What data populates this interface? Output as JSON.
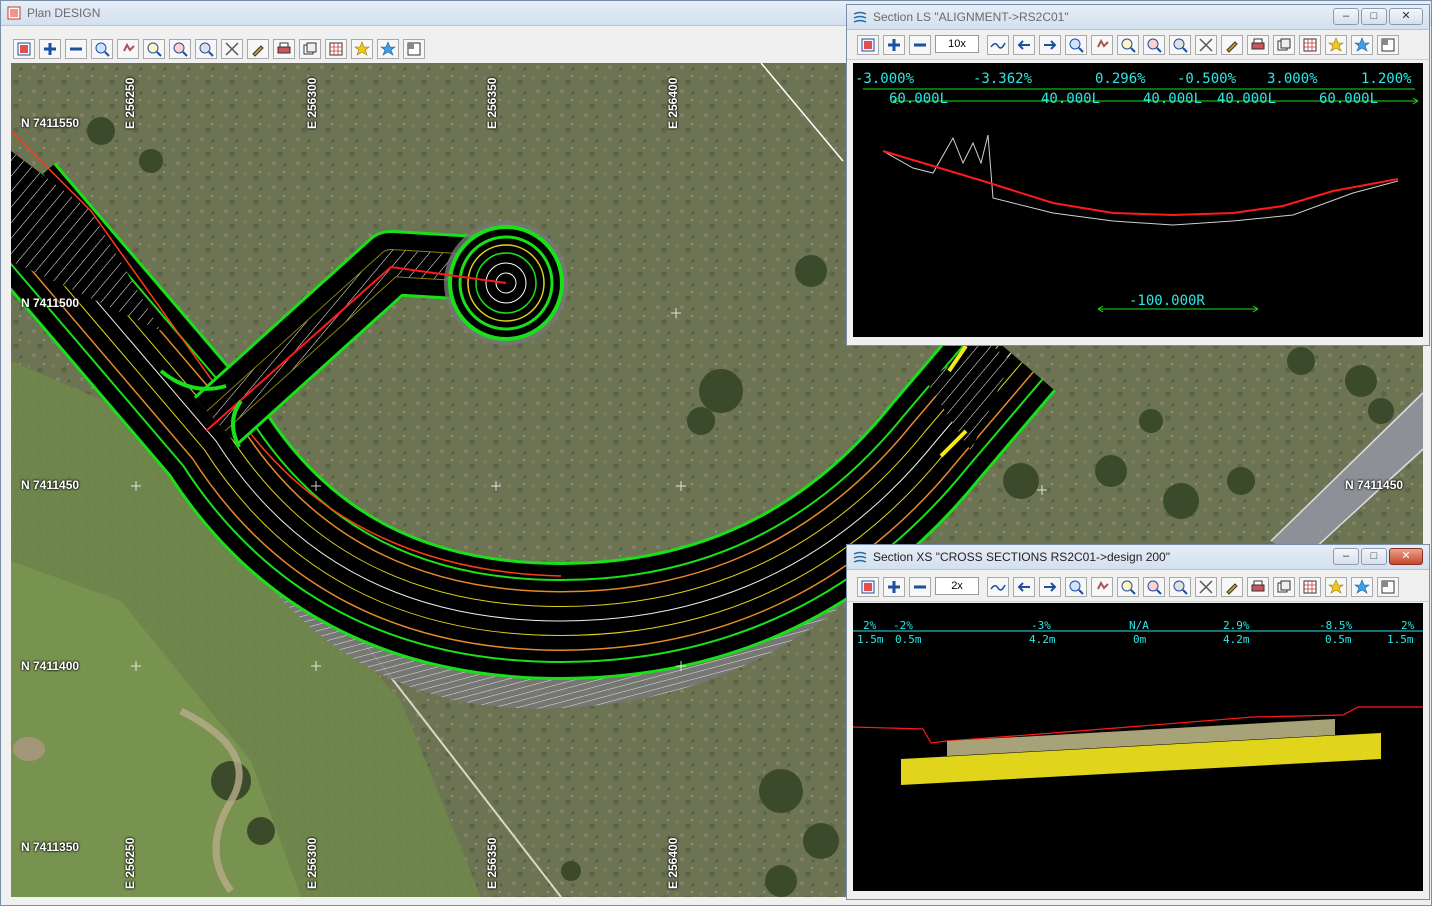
{
  "plan": {
    "title": "Plan DESIGN",
    "grid_north": [
      "N 7411550",
      "N 7411500",
      "N 7411450",
      "N 7411400",
      "N 7411350"
    ],
    "grid_north_right": "N 7411450",
    "grid_east": [
      "E 256250",
      "E 256300",
      "E 256350",
      "E 256400"
    ]
  },
  "ls": {
    "title": "Section LS \"ALIGNMENT->RS2C01\"",
    "zoom": "10x",
    "grades": [
      "-3.000%",
      "-3.362%",
      "0.296%",
      "-0.500%",
      "3.000%",
      "1.200%"
    ],
    "lengths": [
      "60.000L",
      "40.000L",
      "40.000L",
      "40.000L",
      "60.000L"
    ],
    "curve": "-100.000R"
  },
  "xs": {
    "title": "Section XS \"CROSS SECTIONS RS2C01->design 200\"",
    "zoom": "2x",
    "top_labels": [
      "2%",
      "-2%",
      "-3%",
      "N/A",
      "2.9%",
      "-8.5%",
      "2%"
    ],
    "bottom_labels": [
      "1.5m",
      "0.5m",
      "4.2m",
      "0m",
      "4.2m",
      "0.5m",
      "1.5m"
    ]
  },
  "toolbar_icons": [
    "layers-icon",
    "plus-icon",
    "minus-icon",
    "zoom-in-icon",
    "pan-hand-icon",
    "zoom-window-icon",
    "zoom-extent-icon",
    "zoom-out-icon",
    "measure-icon",
    "pick-icon",
    "print-icon",
    "copy-icon",
    "grid-icon",
    "star-yellow-icon",
    "star-blue-icon",
    "window-icon"
  ],
  "colors": {
    "road": "#000000",
    "edge_green": "#19e019",
    "design_red": "#ff1a1a",
    "cyan": "#2ee6e6",
    "pavement_yellow": "#e1d51b",
    "pavement_khaki": "#a8a278"
  }
}
